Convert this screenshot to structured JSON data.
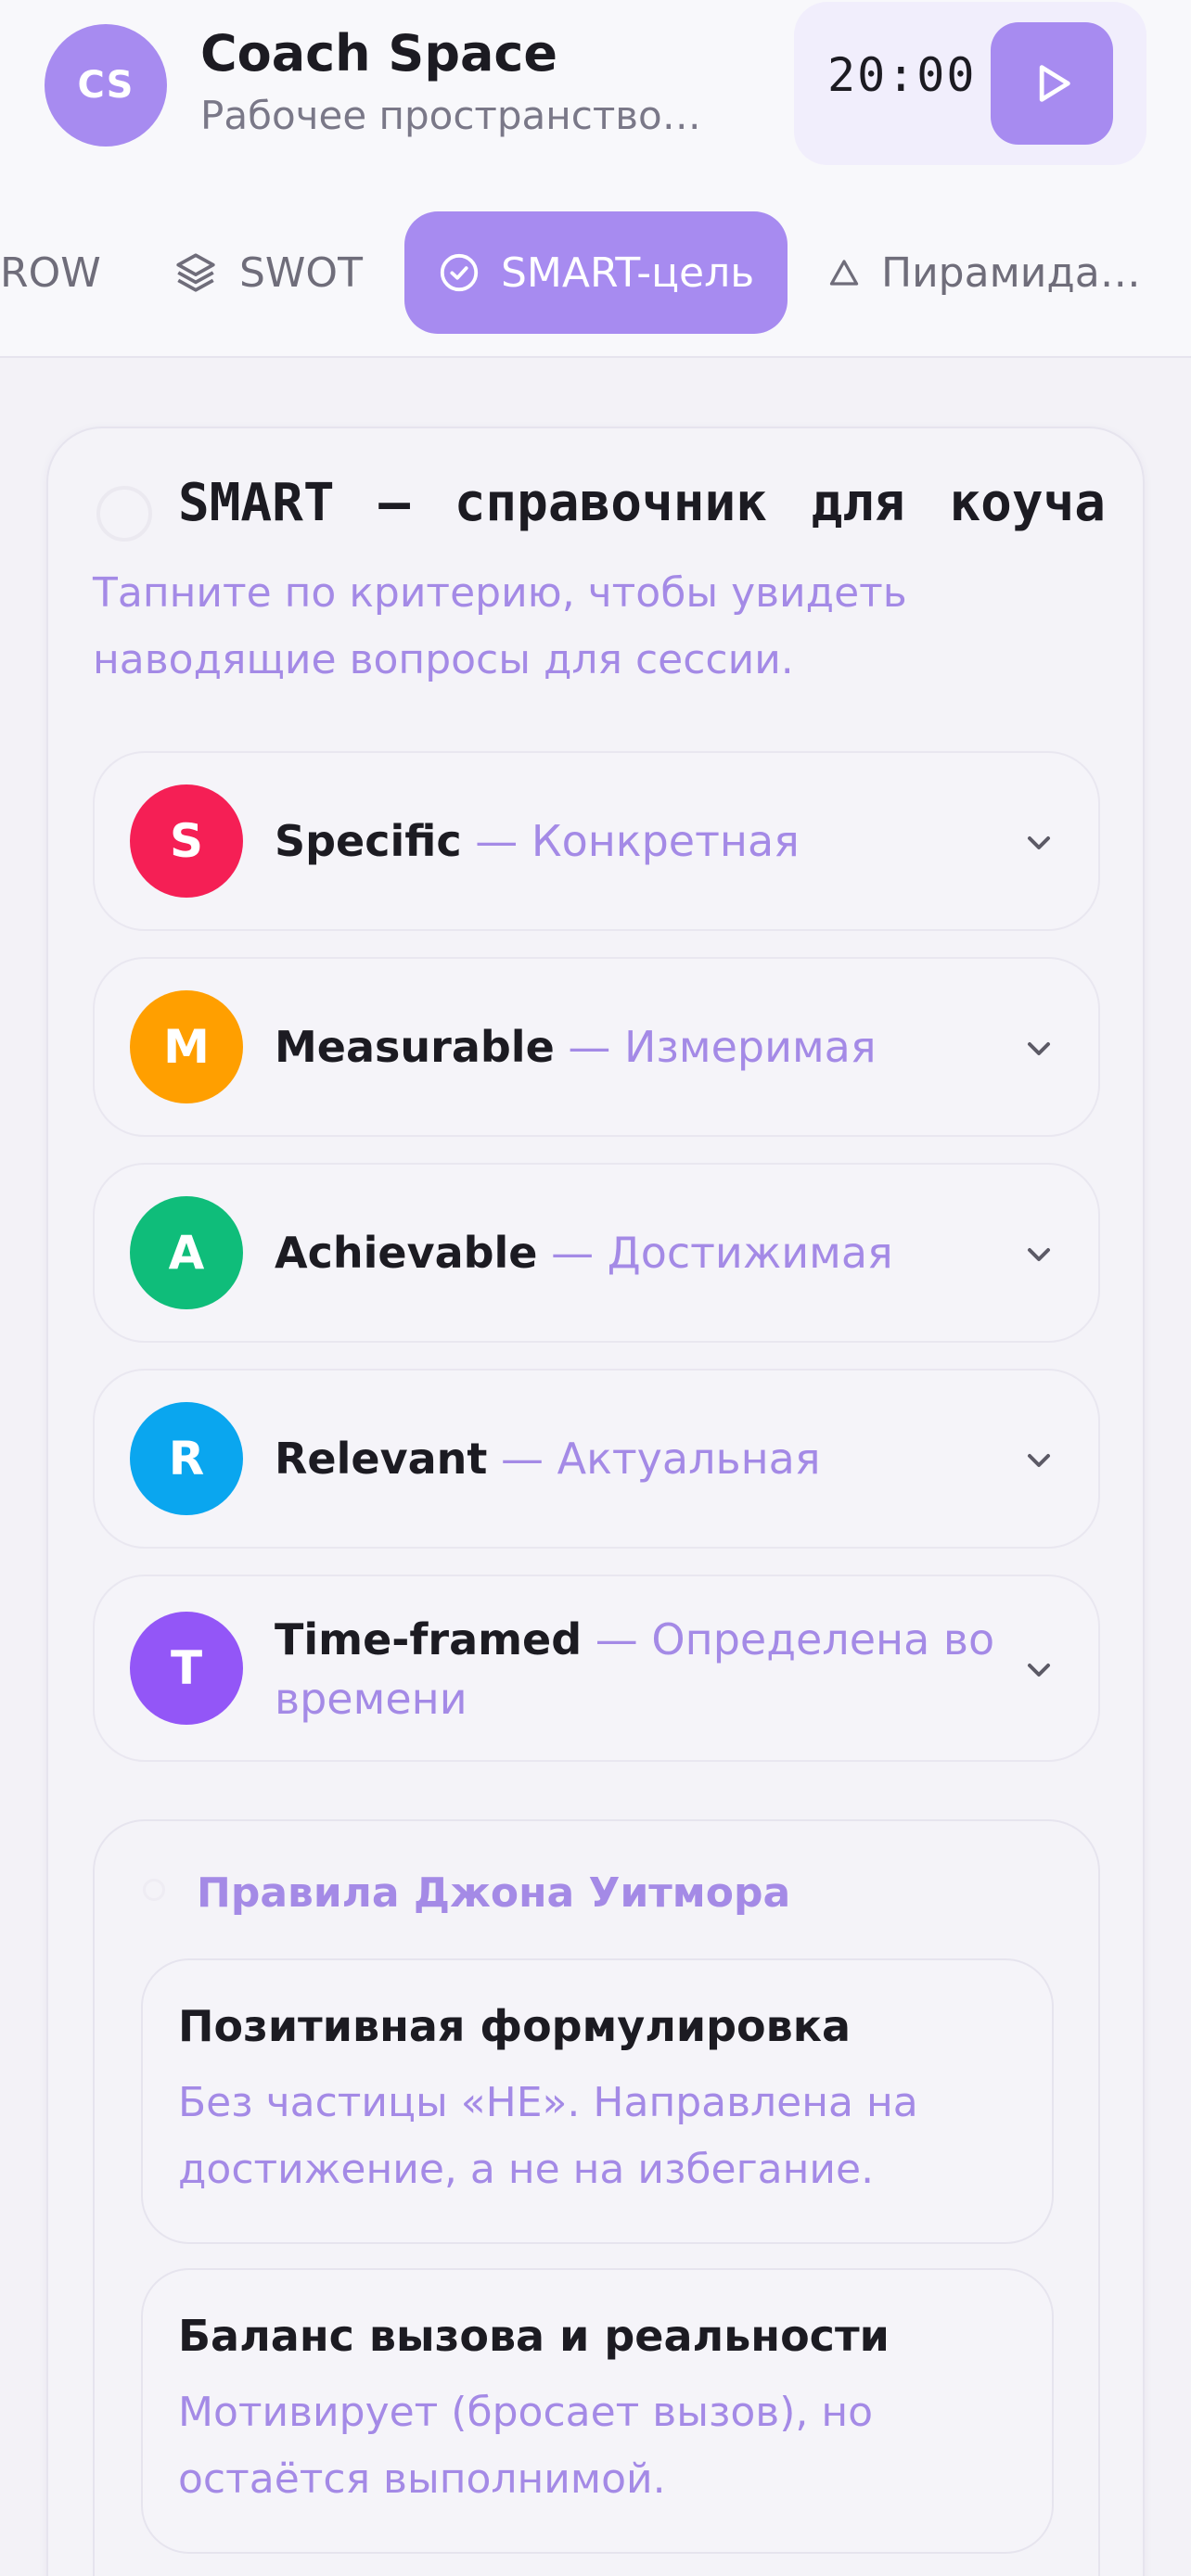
{
  "header": {
    "avatar_initials": "CS",
    "title": "Coach Space",
    "subtitle": "Рабочее пространство…",
    "timer": "20:00",
    "play_icon": "play-icon"
  },
  "tabs": [
    {
      "label": "ROW",
      "icon": "none",
      "active": false
    },
    {
      "label": "SWOT",
      "icon": "layers-icon",
      "active": false
    },
    {
      "label": "SMART-цель",
      "icon": "check-circle-icon",
      "active": true
    },
    {
      "label": "Пирамида …",
      "icon": "triangle-icon",
      "active": false
    }
  ],
  "card": {
    "title": "SMART — справочник для коуча",
    "hint": "Тапните по критерию, чтобы увидеть наводящие вопросы для сессии.",
    "criteria": [
      {
        "letter": "S",
        "name": "Specific",
        "sep": " — ",
        "ru": "Конкретная",
        "color": "#f51f55"
      },
      {
        "letter": "M",
        "name": "Measurable",
        "sep": " — ",
        "ru": "Измеримая",
        "color": "#ff9f00"
      },
      {
        "letter": "A",
        "name": "Achievable",
        "sep": " — ",
        "ru": "Достижимая",
        "color": "#0fbd7a"
      },
      {
        "letter": "R",
        "name": "Relevant",
        "sep": " — ",
        "ru": "Актуальная",
        "color": "#0aa6ef"
      },
      {
        "letter": "T",
        "name": "Time-framed",
        "sep": " — ",
        "ru": "Определена во времени",
        "color": "#9356f7"
      }
    ]
  },
  "rules": {
    "title": "Правила Джона Уитмора",
    "items": [
      {
        "title": "Позитивная формулировка",
        "desc": "Без частицы «НЕ». Направлена на достижение, а не на избегание."
      },
      {
        "title": "Баланс вызова и реальности",
        "desc": "Мотивирует (бросает вызов), но остаётся выполнимой."
      }
    ]
  },
  "colors": {
    "accent": "#a78bf0",
    "accent_text": "#a48ae6",
    "background": "#f3f2f7"
  }
}
